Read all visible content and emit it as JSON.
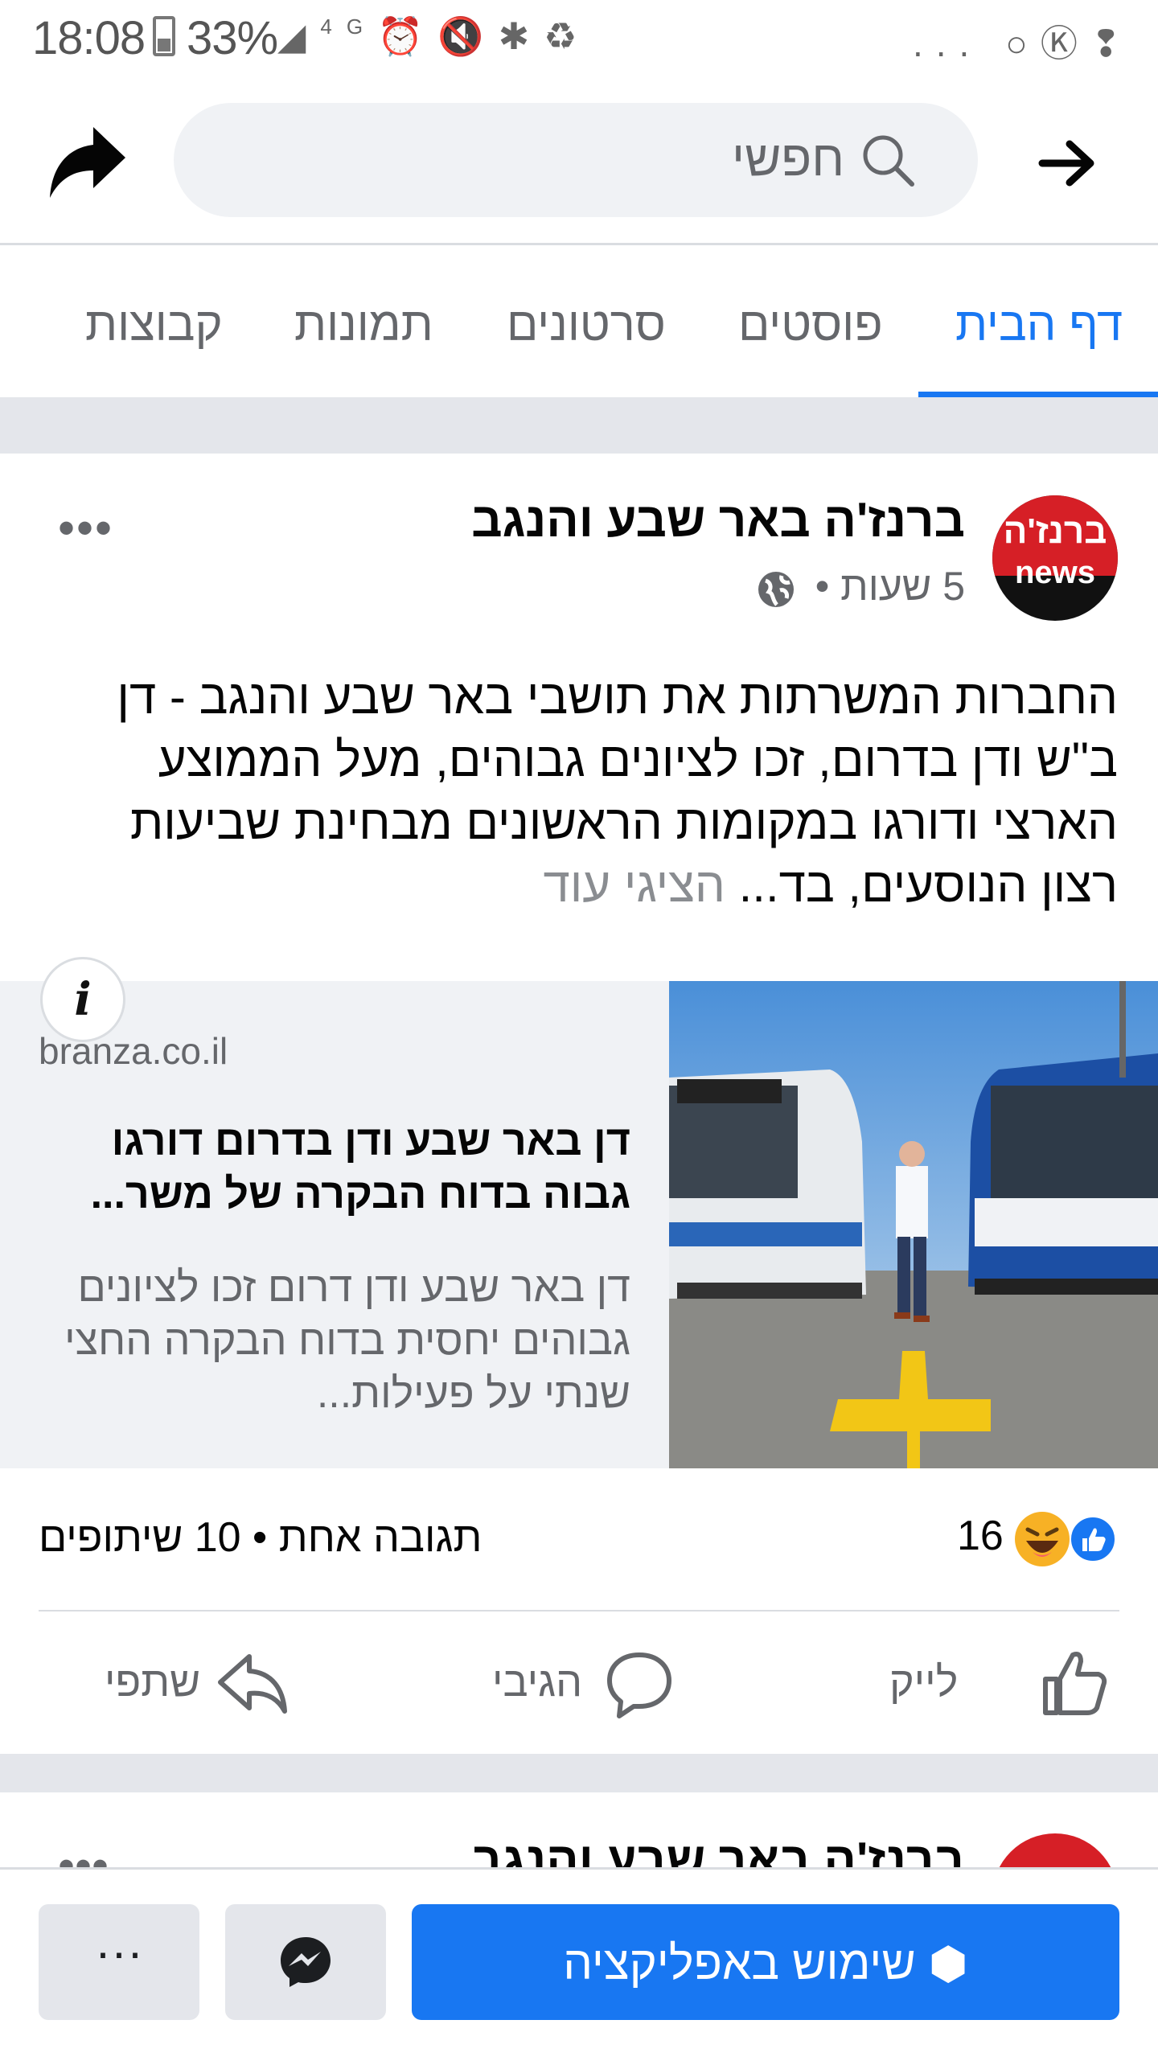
{
  "status_bar": {
    "time": "18:08",
    "battery": "33%",
    "network": "4G",
    "more": "..."
  },
  "header": {
    "search_placeholder": "חפשי",
    "back_icon": "arrow-right-icon",
    "share_icon": "share-arrow-icon"
  },
  "tabs": [
    {
      "label": "דף הבית",
      "active": true
    },
    {
      "label": "פוסטים"
    },
    {
      "label": "סרטונים"
    },
    {
      "label": "תמונות"
    },
    {
      "label": "קבוצות"
    }
  ],
  "post": {
    "page_name": "ברנז'ה באר שבע והנגב",
    "time": "5 שעות",
    "separator": "•",
    "avatar_text_top": "ברנז'ה",
    "avatar_text_bottom": "news",
    "text": "החברות המשרתות את תושבי באר שבע והנגב - דן ב\"ש ודן בדרום, זכו לציונים גבוהים, מעל הממוצע הארצי ודורגו במקומות הראשונים מבחינת שביעות רצון הנוסעים, בד...",
    "see_more": "הציגי עוד",
    "link": {
      "info": "i",
      "domain": "branza.co.il",
      "title": "דן באר שבע ודן בדרום דורגו גבוה בדוח הבקרה של משר...",
      "description": "דן באר שבע ודן דרום זכו לציונים גבוהים יחסית בדוח הבקרה החצי שנתי על פעילות..."
    },
    "reactions_count": "16",
    "comments_shares": "תגובה אחת • 10 שיתופים",
    "actions": {
      "like": "לייק",
      "comment": "הגיבי",
      "share": "שתפי"
    }
  },
  "next_post": {
    "page_name": "ברנז'ה באר שבע והנגב"
  },
  "bottom_bar": {
    "open_app": "שימוש באפליקציה",
    "more": "···"
  },
  "colors": {
    "accent": "#1877f2",
    "secondary_text": "#65676b",
    "brand_red": "#d61f26"
  }
}
